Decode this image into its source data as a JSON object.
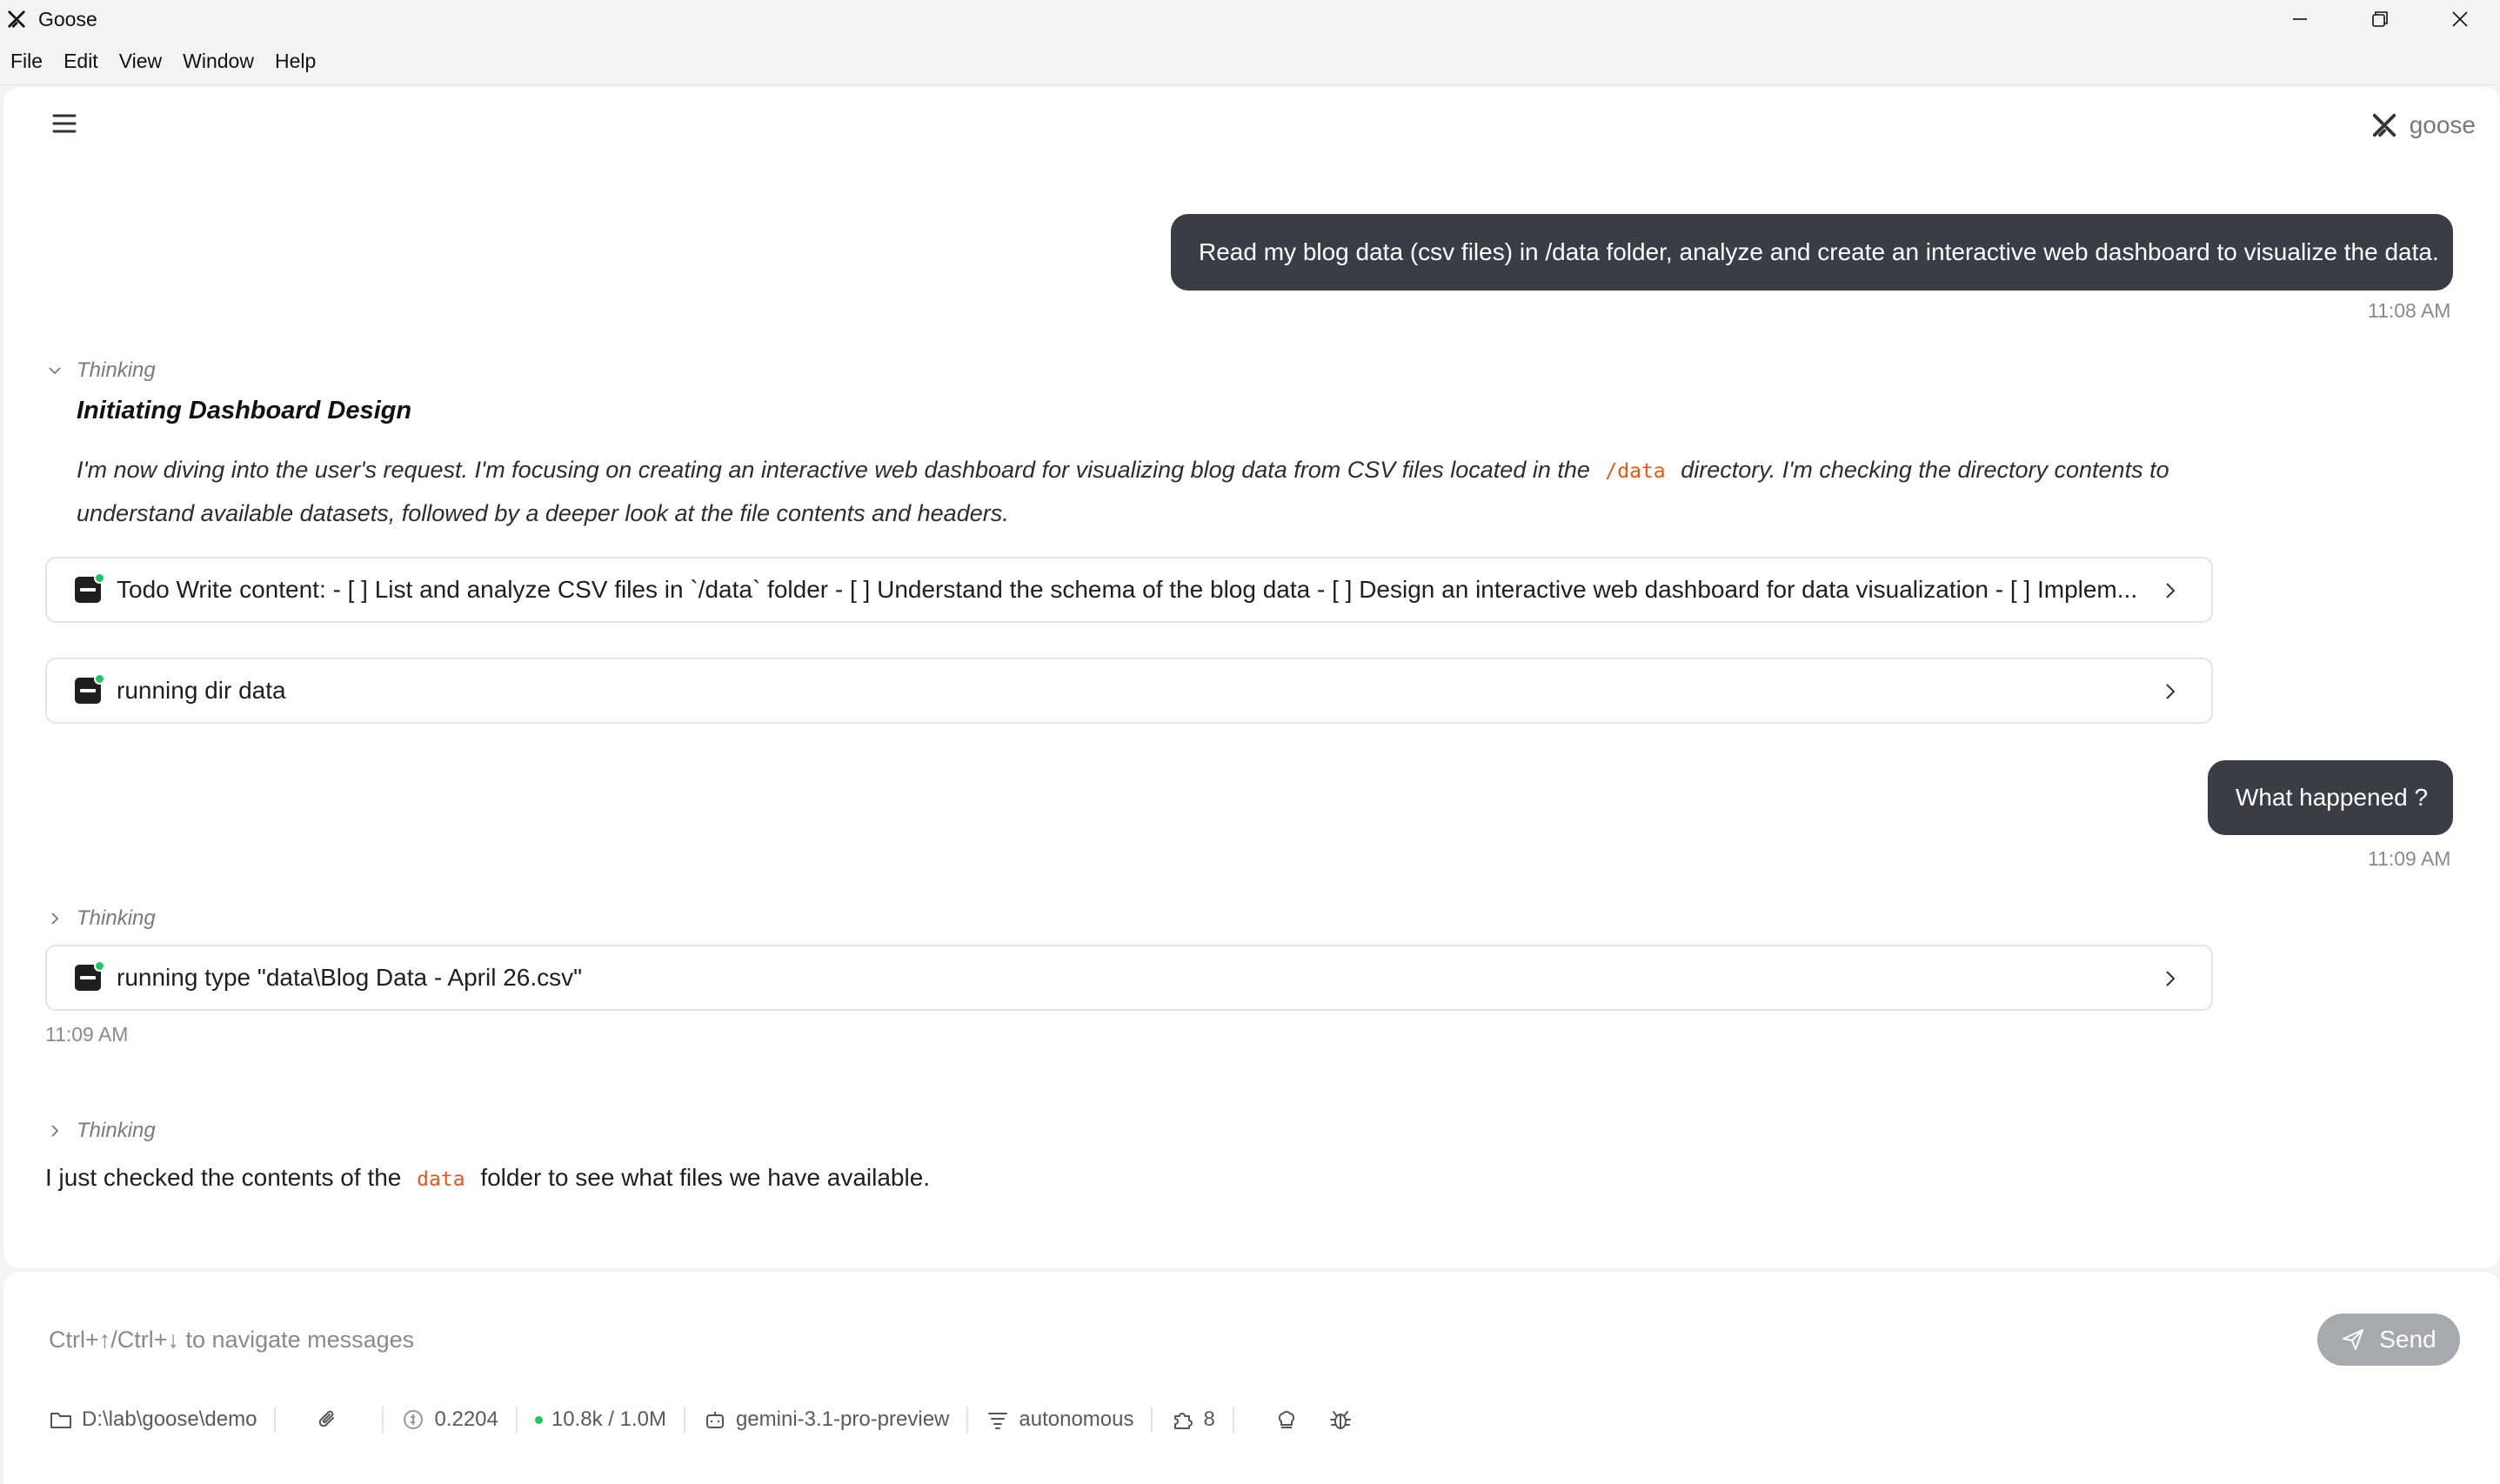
{
  "window": {
    "title": "Goose"
  },
  "menu": [
    "File",
    "Edit",
    "View",
    "Window",
    "Help"
  ],
  "header": {
    "brand": "goose"
  },
  "messages": {
    "user1": {
      "text": "Read my blog data (csv files) in /data folder, analyze and create an interactive web dashboard to visualize the data.",
      "time": "11:08 AM"
    },
    "thinking1": {
      "label": "Thinking",
      "title": "Initiating Dashboard Design",
      "body_part1": "I'm now diving into the user's request. I'm focusing on creating an interactive web dashboard for visualizing blog data from CSV files located in the",
      "body_code": "/data",
      "body_part2": "directory. I'm checking the directory contents to understand available datasets, followed by a deeper look at the file contents and headers."
    },
    "tool1": "Todo Write content: - [ ] List and analyze CSV files in `/data` folder - [ ] Understand the schema of the blog data - [ ] Design an interactive web dashboard for data visualization - [ ] Implem...",
    "tool2": "running dir data",
    "user2": {
      "text": "What happened ?",
      "time": "11:09 AM"
    },
    "thinking2": {
      "label": "Thinking"
    },
    "tool3": "running type \"data\\Blog Data - April 26.csv\"",
    "tool3_time": "11:09 AM",
    "thinking3": {
      "label": "Thinking"
    },
    "reply": {
      "part1": "I just checked the contents of the",
      "code": "data",
      "part2": "folder to see what files we have available."
    }
  },
  "input": {
    "placeholder": "Ctrl+↑/Ctrl+↓ to navigate messages",
    "send_label": "Send"
  },
  "status": {
    "directory": "D:\\lab\\goose\\demo",
    "cost": "0.2204",
    "tokens": "10.8k / 1.0M",
    "model": "gemini-3.1-pro-preview",
    "mode": "autonomous",
    "extensions": "8"
  },
  "colors": {
    "user_bubble": "#3a3d45",
    "code": "#e0571f",
    "status_dot": "#22c55e",
    "send_button": "#a6a9ad"
  }
}
